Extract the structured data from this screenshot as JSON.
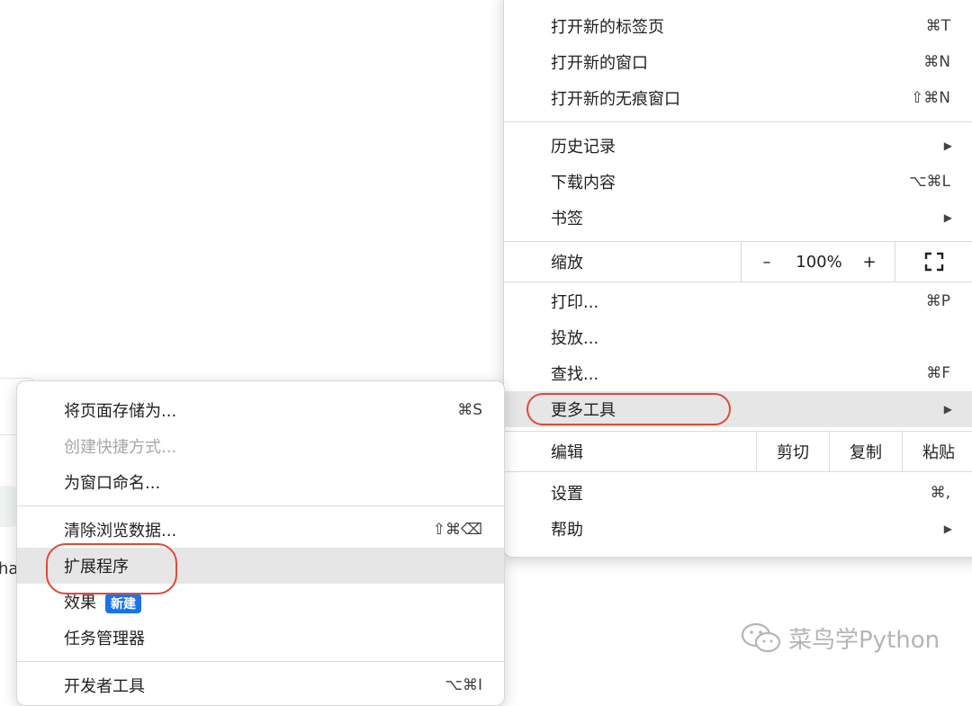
{
  "main_menu": {
    "new_tab": {
      "label": "打开新的标签页",
      "shortcut": "⌘T"
    },
    "new_window": {
      "label": "打开新的窗口",
      "shortcut": "⌘N"
    },
    "new_incognito": {
      "label": "打开新的无痕窗口",
      "shortcut": "⇧⌘N"
    },
    "history": {
      "label": "历史记录"
    },
    "downloads": {
      "label": "下载内容",
      "shortcut": "⌥⌘L"
    },
    "bookmarks": {
      "label": "书签"
    },
    "zoom": {
      "label": "缩放",
      "minus": "–",
      "value": "100%",
      "plus": "+"
    },
    "print": {
      "label": "打印...",
      "shortcut": "⌘P"
    },
    "cast": {
      "label": "投放..."
    },
    "find": {
      "label": "查找...",
      "shortcut": "⌘F"
    },
    "more_tools": {
      "label": "更多工具"
    },
    "edit": {
      "label": "编辑",
      "cut": "剪切",
      "copy": "复制",
      "paste": "粘贴"
    },
    "settings": {
      "label": "设置",
      "shortcut": "⌘,"
    },
    "help": {
      "label": "帮助"
    }
  },
  "sub_menu": {
    "save_page": {
      "label": "将页面存储为...",
      "shortcut": "⌘S"
    },
    "create_shortcut": {
      "label": "创建快捷方式..."
    },
    "name_window": {
      "label": "为窗口命名..."
    },
    "clear_data": {
      "label": "清除浏览数据...",
      "shortcut": "⇧⌘⌫"
    },
    "extensions": {
      "label": "扩展程序"
    },
    "effects": {
      "label": "效果",
      "badge": "新建"
    },
    "task_manager": {
      "label": "任务管理器"
    },
    "dev_tools": {
      "label": "开发者工具",
      "shortcut": "⌥⌘I"
    }
  },
  "background": {
    "partial_text": "ha"
  },
  "watermark": {
    "text": "菜鸟学Python"
  },
  "colors": {
    "highlight": "#e6e6e6",
    "annotation_red": "#e0493a",
    "badge_blue": "#1a73e8"
  }
}
